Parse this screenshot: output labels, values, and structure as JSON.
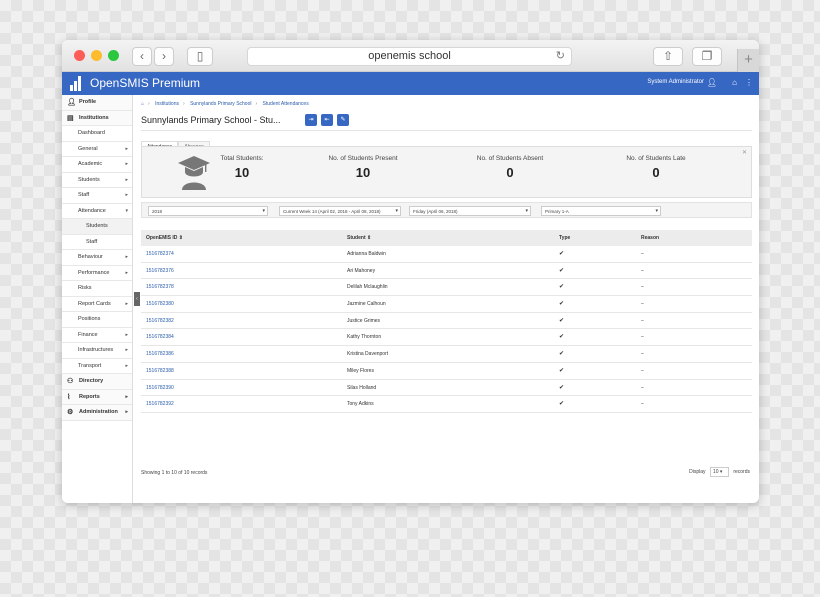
{
  "browser": {
    "url": "openemis school"
  },
  "app": {
    "brand": "OpenSMIS Premium",
    "user": "System Administrator"
  },
  "sidebar": [
    {
      "label": "Profile",
      "level": "top",
      "icon": "user-icon"
    },
    {
      "label": "Institutions",
      "level": "top",
      "icon": "building-icon"
    },
    {
      "label": "Dashboard",
      "level": "item"
    },
    {
      "label": "General",
      "level": "item",
      "caret": "▸"
    },
    {
      "label": "Academic",
      "level": "item",
      "caret": "▸"
    },
    {
      "label": "Students",
      "level": "item",
      "caret": "▸"
    },
    {
      "label": "Staff",
      "level": "item",
      "caret": "▸"
    },
    {
      "label": "Attendance",
      "level": "item",
      "caret": "▾"
    },
    {
      "label": "Students",
      "level": "sub",
      "active": true
    },
    {
      "label": "Staff",
      "level": "sub"
    },
    {
      "label": "Behaviour",
      "level": "item",
      "caret": "▸"
    },
    {
      "label": "Performance",
      "level": "item",
      "caret": "▸"
    },
    {
      "label": "Risks",
      "level": "item"
    },
    {
      "label": "Report Cards",
      "level": "item",
      "caret": "▸"
    },
    {
      "label": "Positions",
      "level": "item"
    },
    {
      "label": "Finance",
      "level": "item",
      "caret": "▸"
    },
    {
      "label": "Infrastructures",
      "level": "item",
      "caret": "▸"
    },
    {
      "label": "Transport",
      "level": "item",
      "caret": "▸"
    },
    {
      "label": "Directory",
      "level": "top",
      "icon": "users-icon"
    },
    {
      "label": "Reports",
      "level": "top",
      "icon": "chart-icon",
      "caret": "▸"
    },
    {
      "label": "Administration",
      "level": "top",
      "icon": "gears-icon",
      "caret": "▸"
    }
  ],
  "breadcrumb": [
    "Institutions",
    "Sunnylands Primary School",
    "Student Attendances"
  ],
  "page_title": "Sunnylands Primary School - Stu...",
  "tabs": [
    "Attendance",
    "Absence"
  ],
  "summary": [
    {
      "label": "Total Students:",
      "value": "10"
    },
    {
      "label": "No. of Students Present",
      "value": "10"
    },
    {
      "label": "No. of Students Absent",
      "value": "0"
    },
    {
      "label": "No. of Students Late",
      "value": "0"
    }
  ],
  "filters": [
    "2018",
    "Current Week 14 (April 02, 2018 - April 08, 2018)",
    "Friday (April 06, 2018)",
    "Primary 1-A"
  ],
  "table": {
    "headers": [
      "OpenEMIS ID",
      "Student",
      "Type",
      "Reason"
    ],
    "rows": [
      {
        "id": "1516782374",
        "name": "Adrianna Baldwin",
        "type": "✔",
        "reason": "–"
      },
      {
        "id": "1516782376",
        "name": "Ari Mahoney",
        "type": "✔",
        "reason": "–"
      },
      {
        "id": "1516782378",
        "name": "Delilah Mclaughlin",
        "type": "✔",
        "reason": "–"
      },
      {
        "id": "1516782380",
        "name": "Jazmine Calhoun",
        "type": "✔",
        "reason": "–"
      },
      {
        "id": "1516782382",
        "name": "Justice Grimes",
        "type": "✔",
        "reason": "–"
      },
      {
        "id": "1516782384",
        "name": "Kathy Thornton",
        "type": "✔",
        "reason": "–"
      },
      {
        "id": "1516782386",
        "name": "Kristina Davenport",
        "type": "✔",
        "reason": "–"
      },
      {
        "id": "1516782388",
        "name": "Miley Flores",
        "type": "✔",
        "reason": "–"
      },
      {
        "id": "1516782390",
        "name": "Silas Holland",
        "type": "✔",
        "reason": "–"
      },
      {
        "id": "1516782392",
        "name": "Tony Adkins",
        "type": "✔",
        "reason": "–"
      }
    ]
  },
  "footer": {
    "showing": "Showing 1 to 10 of 10 records",
    "display_label": "Display",
    "display_value": "10",
    "records_label": "records"
  },
  "colors": {
    "primary": "#3567c3",
    "link": "#2a5caa"
  }
}
